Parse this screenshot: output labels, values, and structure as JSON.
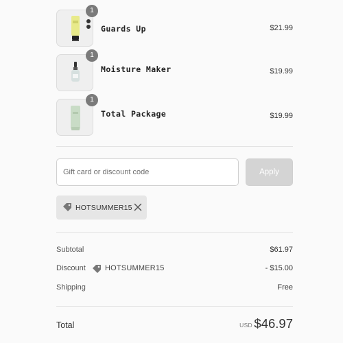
{
  "cart": {
    "items": [
      {
        "name": "Guards Up",
        "price": "$21.99",
        "quantity": "1",
        "image_icon": "yellow-tube-icon"
      },
      {
        "name": "Moisture Maker",
        "price": "$19.99",
        "quantity": "1",
        "image_icon": "dropper-bottle-icon"
      },
      {
        "name": "Total Package",
        "price": "$19.99",
        "quantity": "1",
        "image_icon": "green-tube-icon"
      }
    ]
  },
  "discount": {
    "placeholder": "Gift card or discount code",
    "apply_label": "Apply",
    "applied_code": "HOTSUMMER15",
    "tag_icon": "tag-icon",
    "remove_icon": "close-icon"
  },
  "summary": {
    "subtotal_label": "Subtotal",
    "subtotal_value": "$61.97",
    "discount_label": "Discount",
    "discount_code": "HOTSUMMER15",
    "discount_value": "- $15.00",
    "shipping_label": "Shipping",
    "shipping_value": "Free",
    "total_label": "Total",
    "currency": "USD",
    "total_value": "$46.97"
  },
  "colors": {
    "background": "#fafafa",
    "badge": "#7a7a7a",
    "apply_button": "#d4d4d4",
    "chip": "#e6e6e6",
    "tube_yellow": "#e8ea8a",
    "tube_green": "#c9dcc6"
  }
}
